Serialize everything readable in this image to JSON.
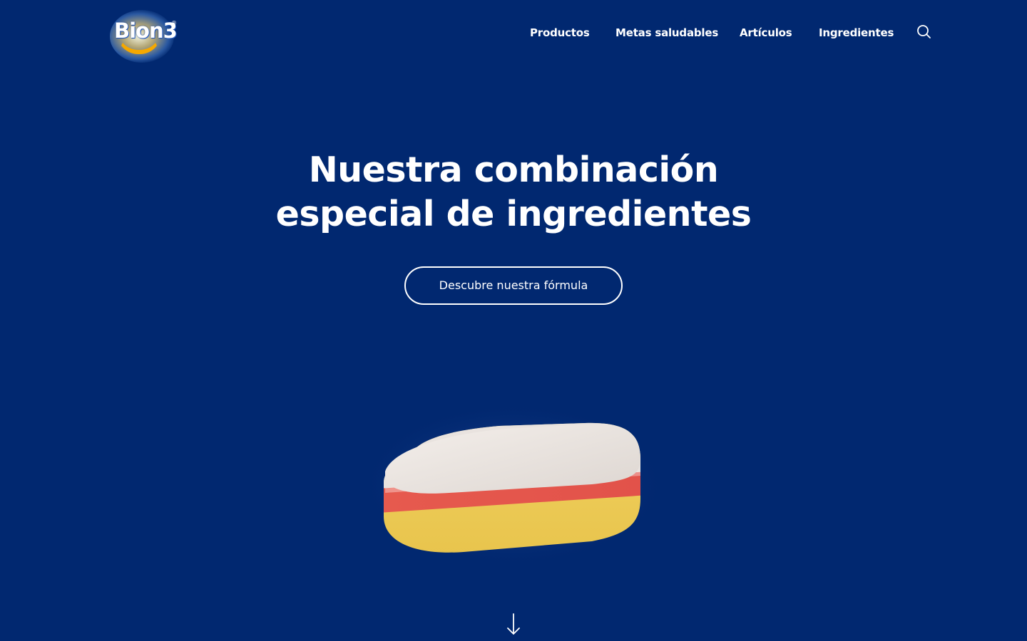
{
  "brand": {
    "logo_text": "Bion3",
    "logo_mark": "®"
  },
  "nav": {
    "items": [
      {
        "label": "Productos"
      },
      {
        "label": "Metas saludables"
      },
      {
        "label": "Artículos"
      },
      {
        "label": "Ingredientes"
      }
    ],
    "search_icon": "search-icon"
  },
  "hero": {
    "title_line1": "Nuestra combinación",
    "title_line2": "especial de ingredientes",
    "cta_label": "Descubre nuestra fórmula",
    "scroll_icon": "arrow-down-icon"
  },
  "colors": {
    "background": "#012870",
    "text": "#ffffff",
    "pill_white": "#ece6e2",
    "pill_red": "#e8584c",
    "pill_yellow": "#f1cf57",
    "logo_accent": "#f5a800"
  }
}
